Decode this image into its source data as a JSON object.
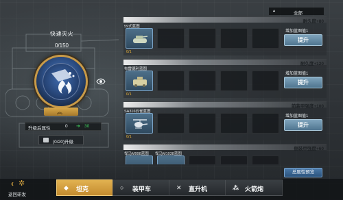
{
  "skill": {
    "title": "快速灭火",
    "progress": "0/150",
    "stat_label": "升级后属性",
    "stat_current": "0",
    "stat_next": "30",
    "upgrade_button": "(0/20)升级"
  },
  "filter": {
    "label": "全部"
  },
  "cards": [
    {
      "effect": "耐久度+80",
      "blueprint": "59式蓝图",
      "blueprint2": "",
      "owned": "0/1",
      "increase": "增加蓝图值1",
      "button": "提升",
      "icon": "tank-icon"
    },
    {
      "effect": "耐久度+120",
      "blueprint": "布雷德利蓝图",
      "blueprint2": "",
      "owned": "0/1",
      "increase": "增加蓝图值1",
      "button": "提升",
      "icon": "ifv-icon"
    },
    {
      "effect": "前装甲强度+100",
      "blueprint": "SA316云雀蓝图",
      "blueprint2": "",
      "owned": "0/1",
      "increase": "增加蓝图值1",
      "button": "提升",
      "icon": "helicopter-icon"
    },
    {
      "effect": "侧装甲强度+60",
      "blueprint": "悍马M998蓝图",
      "blueprint2": "悍马M1038蓝图",
      "owned": "",
      "increase": "",
      "button": "",
      "icon": "humvee-icon"
    }
  ],
  "summary_button": "总属性预览",
  "back": {
    "label": "返回研发"
  },
  "tabs": [
    {
      "label": "坦克",
      "icon": "diamond-icon",
      "active": true
    },
    {
      "label": "装甲车",
      "icon": "circle-icon",
      "active": false
    },
    {
      "label": "直升机",
      "icon": "cross-icon",
      "active": false
    },
    {
      "label": "火箭炮",
      "icon": "trefoil-icon",
      "active": false
    }
  ],
  "colors": {
    "accent": "#d8a640",
    "stat_up": "#3fd45e",
    "active_tab": "#e2b251"
  }
}
